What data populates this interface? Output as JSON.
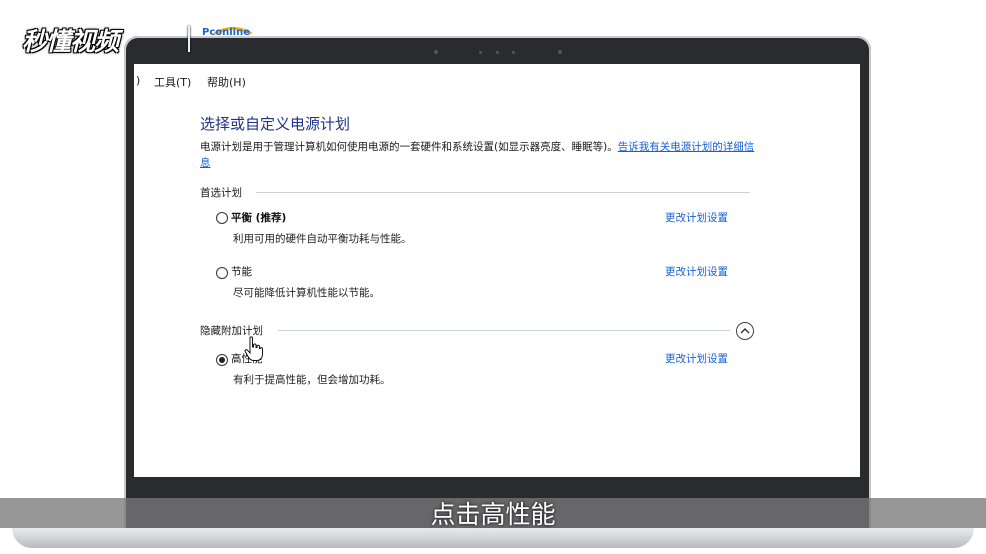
{
  "watermark": {
    "brand": "秒懂视频",
    "partner": "Pconline"
  },
  "menubar": {
    "fragment": ")",
    "tools": "工具(T)",
    "help": "帮助(H)"
  },
  "page": {
    "title": "选择或自定义电源计划",
    "description": "电源计划是用于管理计算机如何使用电源的一套硬件和系统设置(如显示器亮度、睡眠等)。",
    "description_link": "告诉我有关电源计划的详细信息"
  },
  "preferred": {
    "heading": "首选计划",
    "plans": [
      {
        "name": "平衡 (推荐)",
        "desc": "利用可用的硬件自动平衡功耗与性能。",
        "link": "更改计划设置",
        "selected": false
      },
      {
        "name": "节能",
        "desc": "尽可能降低计算机性能以节能。",
        "link": "更改计划设置",
        "selected": false
      }
    ]
  },
  "hidden": {
    "heading": "隐藏附加计划",
    "expand_icon": "chevron-up-icon",
    "plans": [
      {
        "name": "高性能",
        "desc": "有利于提高性能，但会增加功耗。",
        "link": "更改计划设置",
        "selected": true
      }
    ]
  },
  "subtitle": "点击高性能"
}
